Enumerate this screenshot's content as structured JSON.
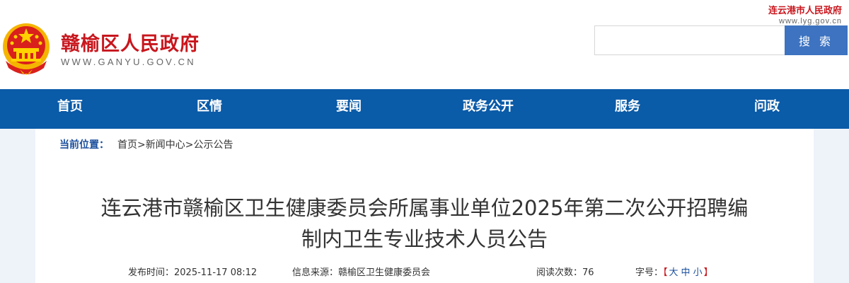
{
  "header": {
    "site_name": "赣榆区人民政府",
    "site_domain": "WWW.GANYU.GOV.CN",
    "parent_site_name": "连云港市人民政府",
    "parent_site_url": "www.lyg.gov.cn",
    "search_button_label": "搜 索",
    "search_placeholder": ""
  },
  "nav": {
    "items": [
      "首页",
      "区情",
      "要闻",
      "政务公开",
      "服务",
      "问政"
    ]
  },
  "breadcrumb": {
    "label": "当前位置：",
    "items": [
      "首页",
      "新闻中心",
      "公示公告"
    ],
    "separator": ">"
  },
  "article": {
    "title": "连云港市赣榆区卫生健康委员会所属事业单位2025年第二次公开招聘编制内卫生专业技术人员公告",
    "publish_time_label": "发布时间：",
    "publish_time": "2025-11-17 08:12",
    "source_label": "信息来源：",
    "source": "赣榆区卫生健康委员会",
    "views_label": "阅读次数：",
    "views": "76",
    "font_size_label": "字号：",
    "font_sizes": [
      "大",
      "中",
      "小"
    ]
  },
  "colors": {
    "brand_red": "#c8161d",
    "nav_blue": "#0a5ba8",
    "search_blue": "#3d73c0"
  }
}
